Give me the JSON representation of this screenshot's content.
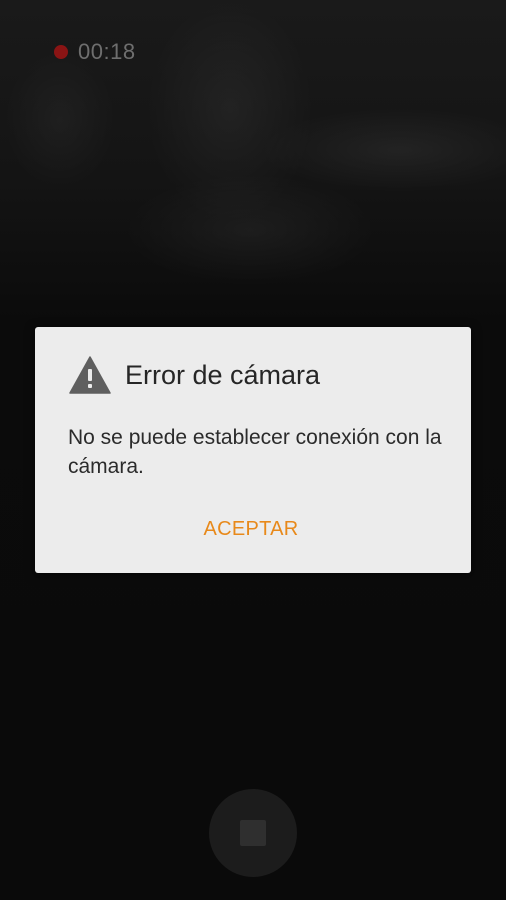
{
  "recording": {
    "elapsed_time": "00:18",
    "indicator_color": "#8a1414"
  },
  "dialog": {
    "icon": "warning-icon",
    "title": "Error de cámara",
    "message": "No se puede establecer conexión con la cámara.",
    "confirm_label": "ACEPTAR",
    "accent_color": "#e8891a"
  },
  "controls": {
    "stop_icon": "stop-icon"
  }
}
